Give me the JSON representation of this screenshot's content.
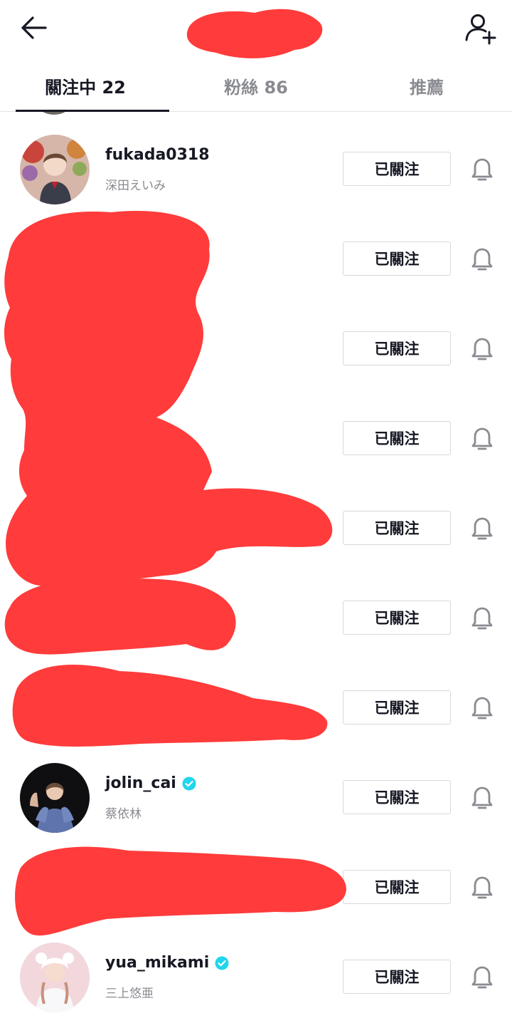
{
  "header": {
    "back_icon": "arrow-left-icon",
    "add_user_icon": "add-user-icon"
  },
  "tabs": [
    {
      "label": "關注中 22",
      "active": true
    },
    {
      "label": "粉絲 86",
      "active": false
    },
    {
      "label": "推薦",
      "active": false
    }
  ],
  "rows": [
    {
      "username": "fukada0318",
      "nickname": "深田えいみ",
      "verified": false,
      "button_label": "已關注",
      "bell_icon": "bell-icon"
    },
    {
      "username": "",
      "nickname": "",
      "verified": false,
      "button_label": "已關注",
      "bell_icon": "bell-icon"
    },
    {
      "username": "",
      "nickname": "",
      "verified": false,
      "button_label": "已關注",
      "bell_icon": "bell-icon"
    },
    {
      "username": "",
      "nickname": "",
      "verified": false,
      "button_label": "已關注",
      "bell_icon": "bell-icon"
    },
    {
      "username": "",
      "nickname": "",
      "verified": false,
      "button_label": "已關注",
      "bell_icon": "bell-icon"
    },
    {
      "username": "",
      "nickname": "",
      "verified": false,
      "button_label": "已關注",
      "bell_icon": "bell-icon"
    },
    {
      "username": "",
      "nickname": "",
      "verified": false,
      "button_label": "已關注",
      "bell_icon": "bell-icon"
    },
    {
      "username": "jolin_cai",
      "nickname": "蔡依林",
      "verified": true,
      "button_label": "已關注",
      "bell_icon": "bell-icon"
    },
    {
      "username": "",
      "nickname": "",
      "verified": false,
      "button_label": "已關注",
      "bell_icon": "bell-icon"
    },
    {
      "username": "yua_mikami",
      "nickname": "三上悠亜",
      "verified": true,
      "button_label": "已關注",
      "bell_icon": "bell-icon"
    }
  ],
  "colors": {
    "text_primary": "#161823",
    "text_secondary": "#8a8b91",
    "divider": "#e3e3e4",
    "verified": "#20d5ec",
    "redaction": "#ff3b3b"
  }
}
